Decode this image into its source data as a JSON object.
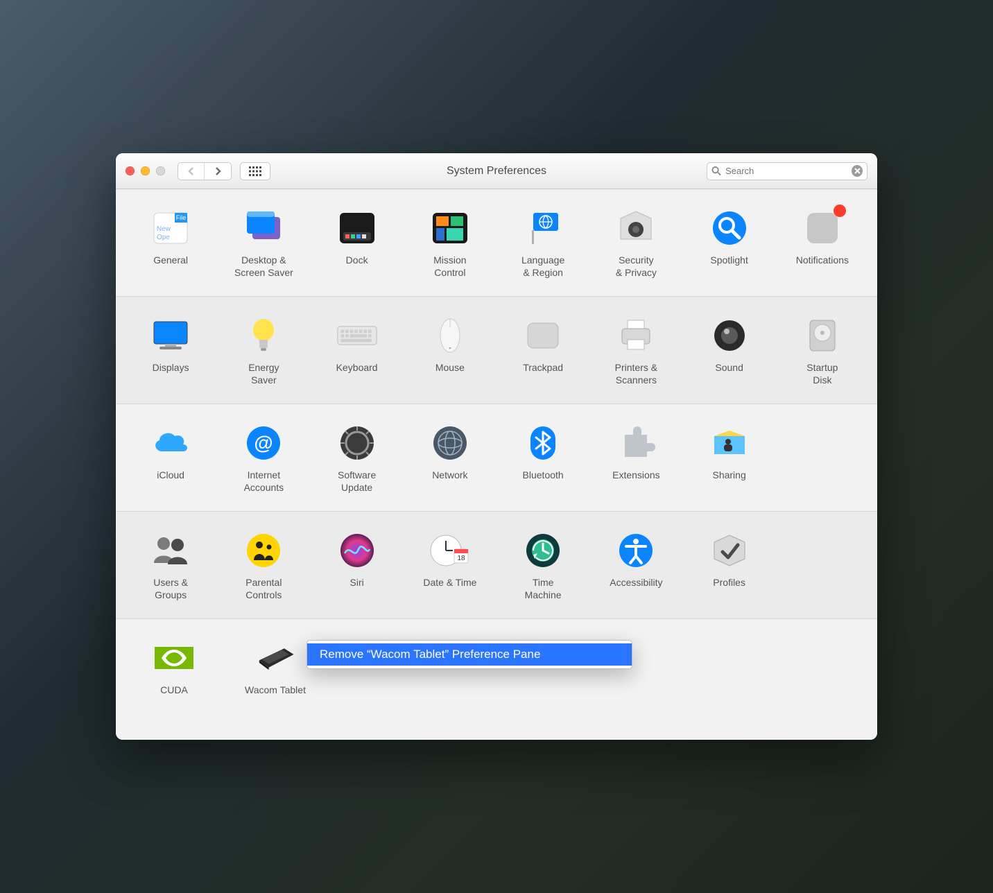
{
  "window": {
    "title": "System Preferences",
    "search_placeholder": "Search"
  },
  "context_menu": {
    "remove_label": "Remove “Wacom Tablet” Preference Pane"
  },
  "rows": [
    [
      {
        "id": "general",
        "label": "General"
      },
      {
        "id": "desktop",
        "label": "Desktop &\nScreen Saver"
      },
      {
        "id": "dock",
        "label": "Dock"
      },
      {
        "id": "mission",
        "label": "Mission\nControl"
      },
      {
        "id": "language",
        "label": "Language\n& Region"
      },
      {
        "id": "security",
        "label": "Security\n& Privacy"
      },
      {
        "id": "spotlight",
        "label": "Spotlight"
      },
      {
        "id": "notifications",
        "label": "Notifications",
        "badge": true
      }
    ],
    [
      {
        "id": "displays",
        "label": "Displays"
      },
      {
        "id": "energy",
        "label": "Energy\nSaver"
      },
      {
        "id": "keyboard",
        "label": "Keyboard"
      },
      {
        "id": "mouse",
        "label": "Mouse"
      },
      {
        "id": "trackpad",
        "label": "Trackpad"
      },
      {
        "id": "printers",
        "label": "Printers &\nScanners"
      },
      {
        "id": "sound",
        "label": "Sound"
      },
      {
        "id": "startup",
        "label": "Startup\nDisk"
      }
    ],
    [
      {
        "id": "icloud",
        "label": "iCloud"
      },
      {
        "id": "internet",
        "label": "Internet\nAccounts"
      },
      {
        "id": "swupdate",
        "label": "Software\nUpdate"
      },
      {
        "id": "network",
        "label": "Network"
      },
      {
        "id": "bluetooth",
        "label": "Bluetooth"
      },
      {
        "id": "extensions",
        "label": "Extensions"
      },
      {
        "id": "sharing",
        "label": "Sharing"
      }
    ],
    [
      {
        "id": "users",
        "label": "Users &\nGroups"
      },
      {
        "id": "parental",
        "label": "Parental\nControls"
      },
      {
        "id": "siri",
        "label": "Siri"
      },
      {
        "id": "datetime",
        "label": "Date & Time"
      },
      {
        "id": "timemachine",
        "label": "Time\nMachine"
      },
      {
        "id": "accessibility",
        "label": "Accessibility"
      },
      {
        "id": "profiles",
        "label": "Profiles"
      }
    ],
    [
      {
        "id": "cuda",
        "label": "CUDA"
      },
      {
        "id": "wacom",
        "label": "Wacom Tablet"
      }
    ]
  ]
}
